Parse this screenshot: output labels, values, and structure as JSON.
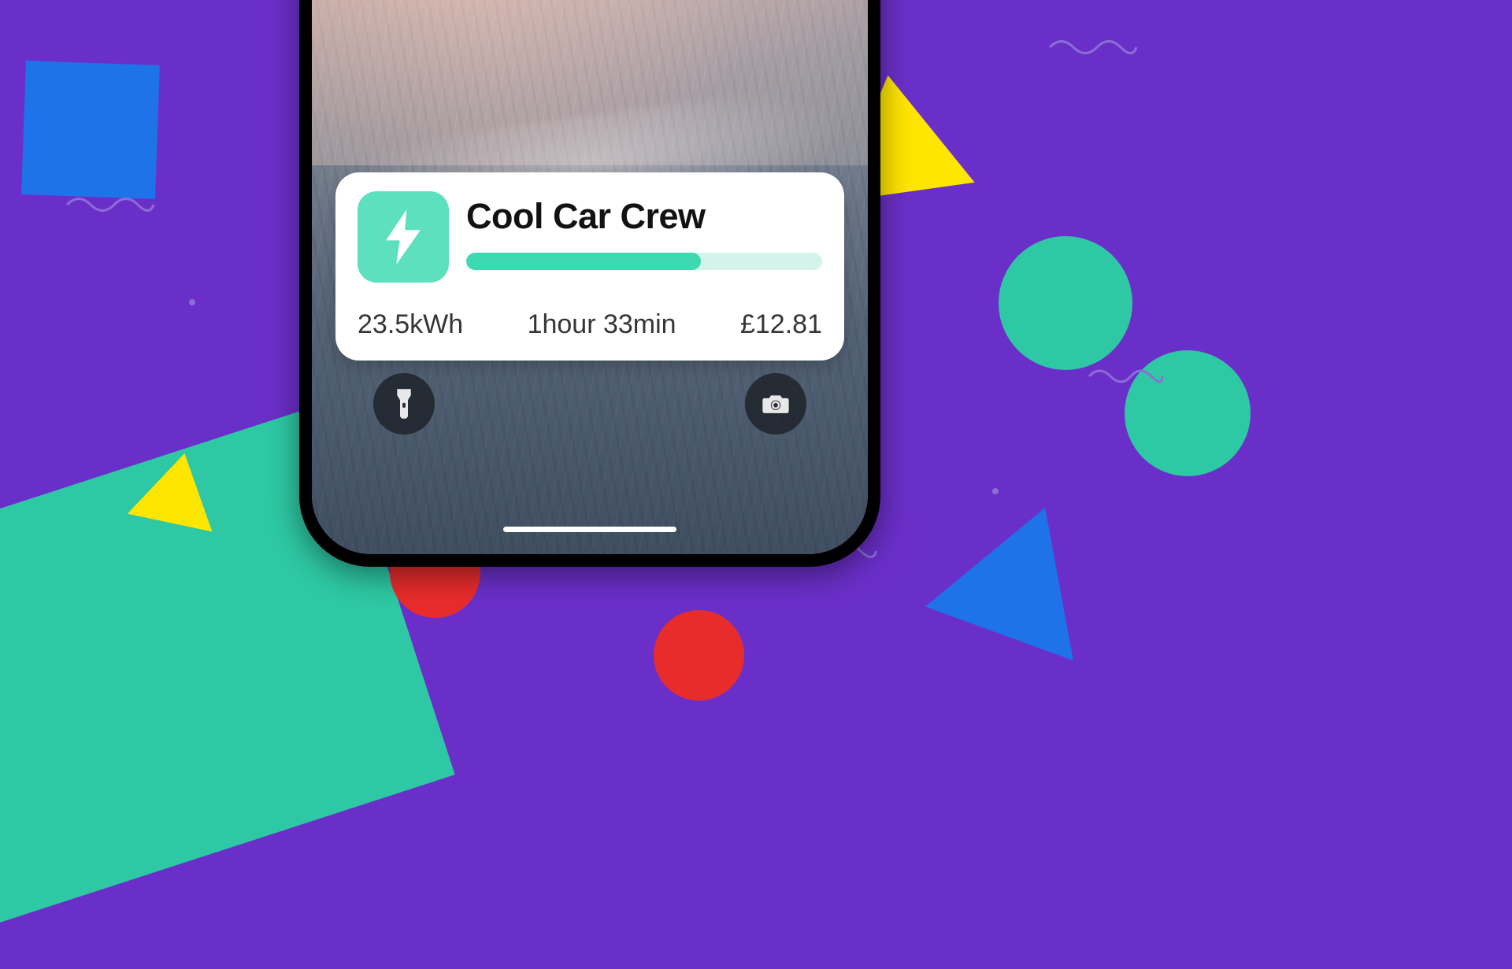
{
  "background": {
    "base_color": "#6b2fc9",
    "shapes": {
      "blue_square": "#1e73e8",
      "teal_block": "#2ec9a4",
      "yellow_triangle": "#ffe600",
      "green_circle": "#2ec9a4",
      "blue_triangle": "#1e73e8",
      "red_circle": "#e82c2c"
    }
  },
  "lockscreen": {
    "flashlight_icon": "flashlight-icon",
    "camera_icon": "camera-icon"
  },
  "widget": {
    "app_icon": "bolt-icon",
    "title": "Cool Car Crew",
    "progress_percent": 66,
    "stats": {
      "energy": "23.5kWh",
      "duration": "1hour 33min",
      "cost": "£12.81"
    }
  }
}
